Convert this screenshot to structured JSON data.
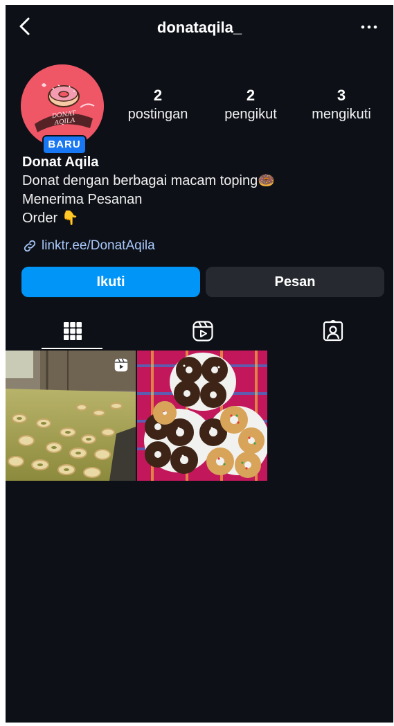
{
  "header": {
    "username": "donataqila_",
    "back_icon": "chevron-left-icon",
    "more_icon": "more-horizontal-icon"
  },
  "profile": {
    "avatar_text": "DONAT AQILA",
    "badge": "BARU",
    "stats": [
      {
        "value": "2",
        "label": "postingan"
      },
      {
        "value": "2",
        "label": "pengikut"
      },
      {
        "value": "3",
        "label": "mengikuti"
      }
    ],
    "name": "Donat Aqila",
    "bio_lines": [
      "Donat dengan berbagai macam toping🍩",
      "Menerima Pesanan",
      "Order 👇"
    ],
    "link": "linktr.ee/DonatAqila"
  },
  "actions": {
    "follow_label": "Ikuti",
    "message_label": "Pesan"
  },
  "tabs": [
    {
      "name": "posts",
      "icon": "grid-icon",
      "active": true
    },
    {
      "name": "reels",
      "icon": "reels-icon",
      "active": false
    },
    {
      "name": "tagged",
      "icon": "tagged-person-icon",
      "active": false
    }
  ],
  "posts": [
    {
      "type": "reel",
      "subject": "plain donuts frying in oil"
    },
    {
      "type": "photo",
      "subject": "topped donuts on plates"
    }
  ],
  "colors": {
    "background": "#0d1117",
    "primary_button": "#0095f6",
    "secondary_button": "#262a30",
    "link": "#a8c7fa",
    "badge": "#1877f2",
    "avatar": "#ef5666"
  }
}
